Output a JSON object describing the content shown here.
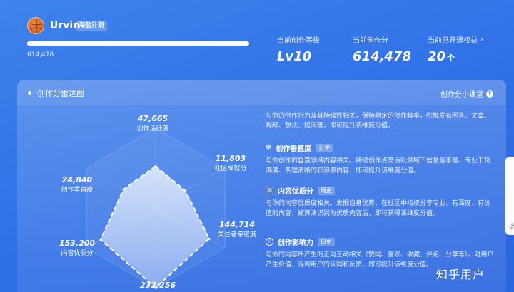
{
  "user": {
    "name": "Urvin",
    "plan_badge": "海盐计划",
    "score_text": "614,478",
    "progress_fraction": 1.0
  },
  "stats": {
    "level": {
      "label": "当前创作等级",
      "value": "Lv10"
    },
    "score": {
      "label": "当前创作分",
      "value": "614,478"
    },
    "rights": {
      "label": "当前已开通权益",
      "value": "20",
      "unit": "个",
      "arrow": "›"
    }
  },
  "card": {
    "title": "创作分雷达图",
    "class_link": "创作分小课堂",
    "class_icon": "?"
  },
  "radar": {
    "dimensions": [
      {
        "name": "创作活跃度",
        "value": "47,665"
      },
      {
        "name": "社区成就分",
        "value": "11,803"
      },
      {
        "name": "关注者亲密度",
        "value": "144,714"
      },
      {
        "name": "",
        "value": "232,256"
      },
      {
        "name": "内容优质分",
        "value": "153,200"
      },
      {
        "name": "创作垂直度",
        "value": "24,840"
      }
    ]
  },
  "chart_data": {
    "type": "radar",
    "title": "创作分雷达图",
    "axes": [
      "创作活跃度",
      "社区成就分",
      "关注者亲密度",
      "",
      "内容优质分",
      "创作垂直度"
    ],
    "series": [
      {
        "values": [
          47665,
          11803,
          144714,
          232256,
          153200,
          24840
        ]
      }
    ]
  },
  "dimensions_desc": {
    "top_partial": "与你的创作行为及其持续性相关。保持稳定的创作频率，积极发布回答、文章、视频、想法、提问等，即可提升该维度分值。",
    "items": [
      {
        "title": "创作垂直度",
        "tag": "日更",
        "icon": "❄",
        "text": "与你创作的垂直领域内容相关。持续创作点亮活跃领域下信息量丰富、专业干货满满、条理清晰的获得感内容，即可提升该维度分值。"
      },
      {
        "title": "内容优质分",
        "tag": "周更",
        "icon": "▤",
        "text": "与你的内容优质度相关。发掘自身优势，在社区中持续分享专业、有深度、有价值的内容，被算法识别为优质内容后，即可获得该维度分值。"
      },
      {
        "title": "创作影响力",
        "tag": "日更",
        "icon": "☆",
        "text": "与你的内容所产生的正向互动相关（赞同、喜欢、收藏、评论、分享等）。对用户产生价值，得到用户的认同和反馈，即可提升该维度分值。"
      }
    ]
  },
  "right_tab": {
    "text": "小"
  },
  "watermark": "知乎用户"
}
